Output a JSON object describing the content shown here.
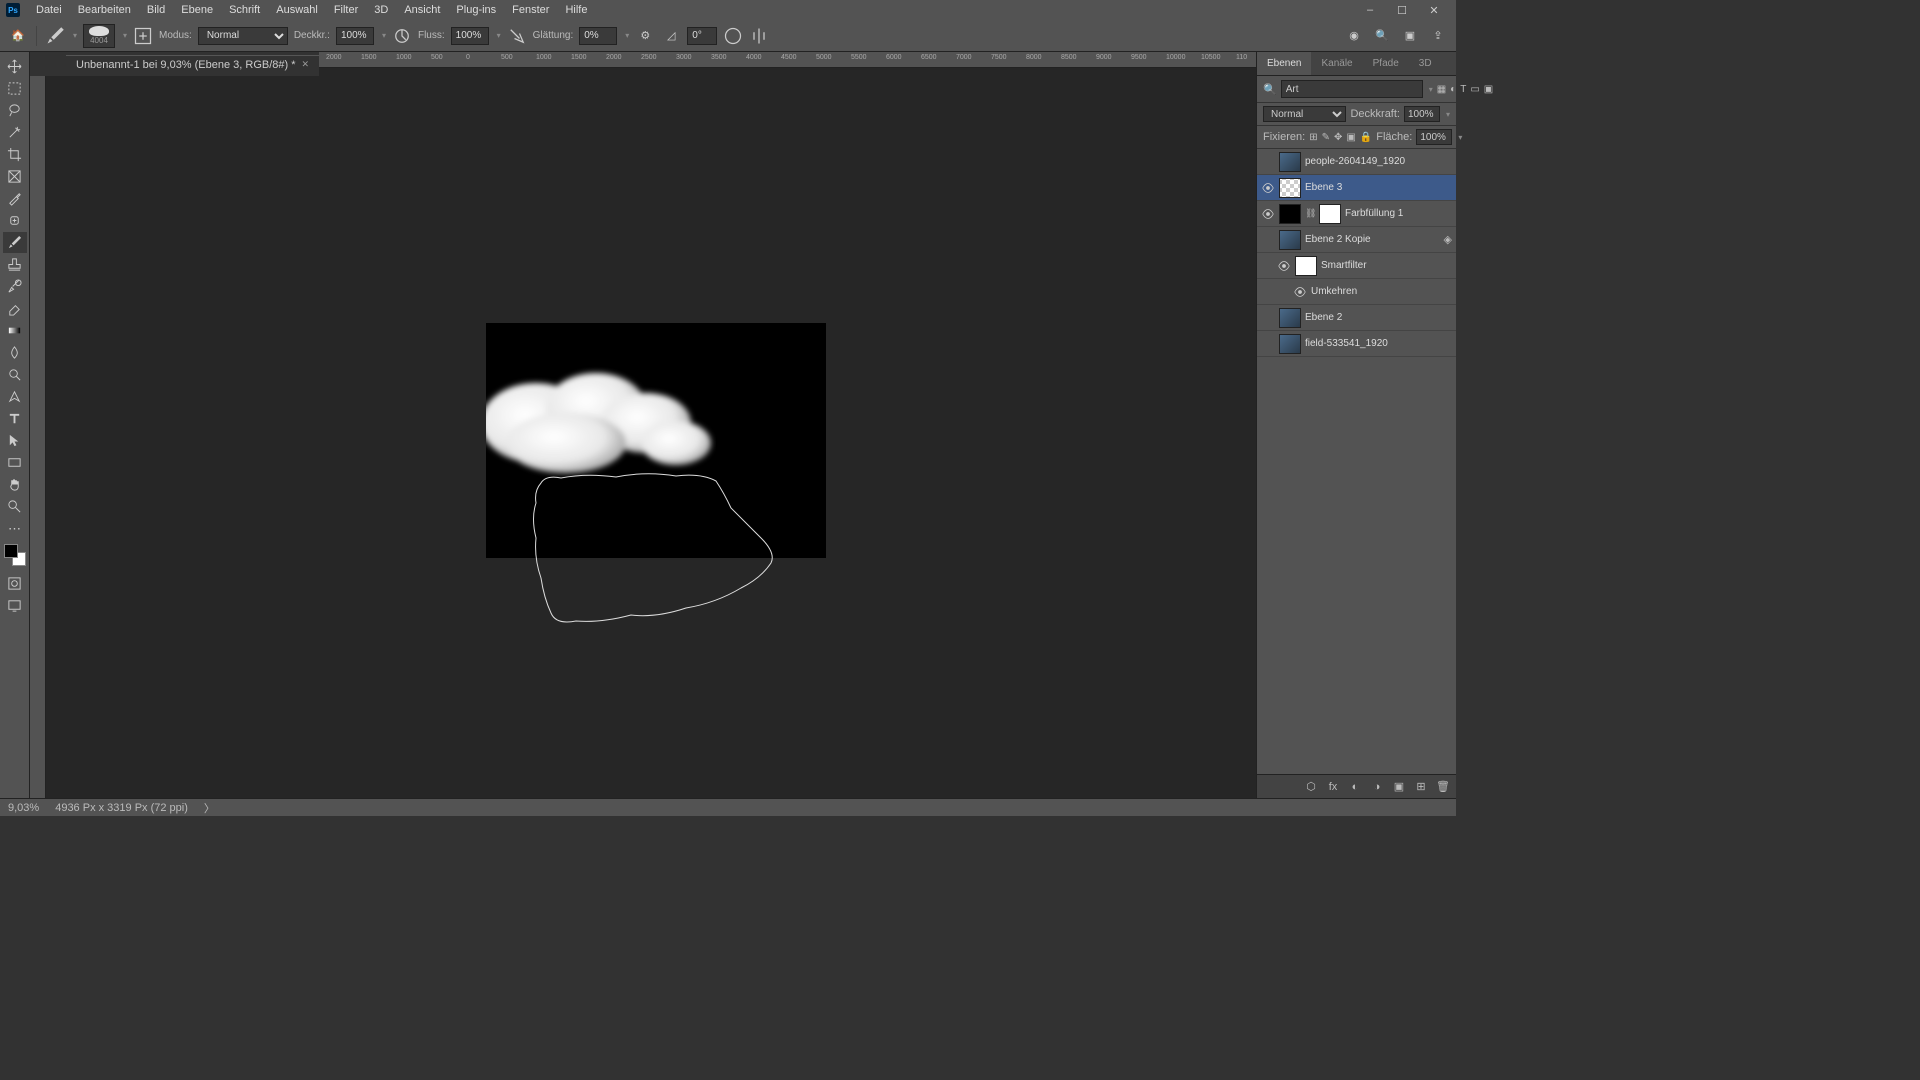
{
  "menu": [
    "Datei",
    "Bearbeiten",
    "Bild",
    "Ebene",
    "Schrift",
    "Auswahl",
    "Filter",
    "3D",
    "Ansicht",
    "Plug-ins",
    "Fenster",
    "Hilfe"
  ],
  "window_controls": [
    "–",
    "☐",
    "✕"
  ],
  "options": {
    "brush_size": "4004",
    "modus_label": "Modus:",
    "modus_value": "Normal",
    "deckkraft_label": "Deckkr.:",
    "deckkraft_value": "100%",
    "fluss_label": "Fluss:",
    "fluss_value": "100%",
    "glattung_label": "Glättung:",
    "glattung_value": "0%",
    "angle_value": "0°"
  },
  "doc": {
    "title": "Unbenannt-1 bei 9,03% (Ebene 3, RGB/8#) *"
  },
  "ruler_ticks": [
    "6000",
    "5500",
    "5000",
    "4500",
    "4000",
    "3500",
    "3000",
    "2500",
    "2000",
    "1500",
    "1000",
    "500",
    "0",
    "500",
    "1000",
    "1500",
    "2000",
    "2500",
    "3000",
    "3500",
    "4000",
    "4500",
    "5000",
    "5500",
    "6000",
    "6500",
    "7000",
    "7500",
    "8000",
    "8500",
    "9000",
    "9500",
    "10000",
    "10500",
    "110"
  ],
  "panel": {
    "tabs": [
      "Ebenen",
      "Kanäle",
      "Pfade",
      "3D"
    ],
    "search_placeholder": "Art",
    "blend_mode": "Normal",
    "deckkraft_label": "Deckkraft:",
    "deckkraft_value": "100%",
    "fixieren_label": "Fixieren:",
    "flache_label": "Fläche:",
    "flache_value": "100%"
  },
  "layers": [
    {
      "name": "people-2604149_1920",
      "visible": false,
      "thumb": "img",
      "selected": false
    },
    {
      "name": "Ebene 3",
      "visible": true,
      "thumb": "checker",
      "selected": true
    },
    {
      "name": "Farbfüllung 1",
      "visible": true,
      "thumb": "black",
      "mask": "white",
      "link": true,
      "selected": false
    },
    {
      "name": "Ebene 2 Kopie",
      "visible": false,
      "thumb": "img",
      "smart": true,
      "selected": false
    },
    {
      "name": "Smartfilter",
      "visible": true,
      "thumb": "white",
      "indent": 1,
      "selected": false
    },
    {
      "name": "Umkehren",
      "visible": true,
      "indent": 2,
      "selected": false,
      "nothumb": true
    },
    {
      "name": "Ebene 2",
      "visible": false,
      "thumb": "img",
      "selected": false
    },
    {
      "name": "field-533541_1920",
      "visible": false,
      "thumb": "img",
      "selected": false
    }
  ],
  "status": {
    "zoom": "9,03%",
    "dims": "4936 Px x 3319 Px (72 ppi)"
  }
}
